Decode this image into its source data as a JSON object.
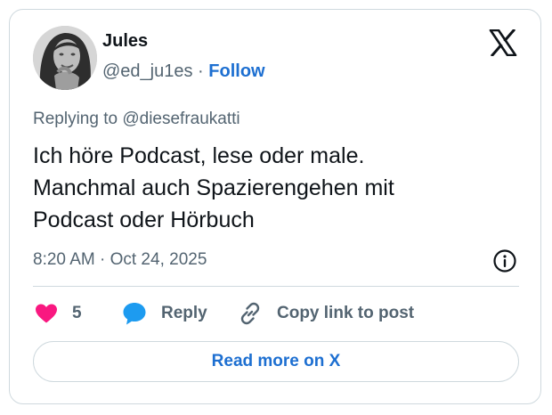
{
  "author": {
    "name": "Jules",
    "handle": "@ed_ju1es",
    "separator": "·",
    "follow_label": "Follow",
    "avatar_icon": "profile-photo"
  },
  "brand_icon": "x-logo-icon",
  "replying_to": "Replying to @diesefraukatti",
  "tweet_text": "Ich höre Podcast, lese oder male.\nManchmal auch Spazierengehen mit\nPodcast oder Hörbuch",
  "timestamp": "8:20 AM · Oct 24, 2025",
  "actions": {
    "like_count": "5",
    "reply_label": "Reply",
    "copy_label": "Copy link to post"
  },
  "read_more_label": "Read more on X",
  "colors": {
    "link": "#1d6fd1",
    "heart": "#f91880",
    "reply_bubble": "#1d9bf0",
    "muted_text": "#536471",
    "border": "#cfd9de"
  }
}
